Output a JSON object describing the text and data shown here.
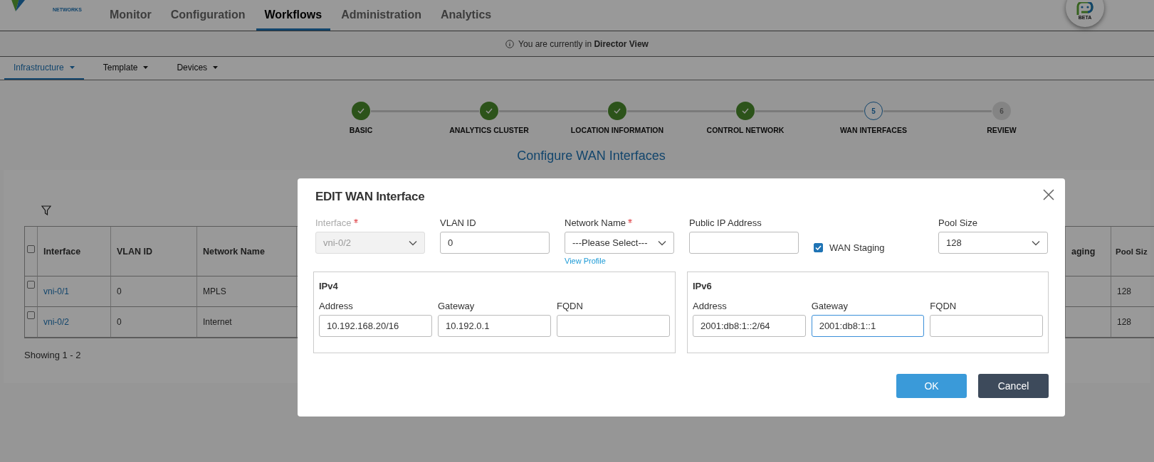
{
  "header": {
    "logo_text": "NETWORKS",
    "nav": [
      {
        "label": "Monitor",
        "selected": false
      },
      {
        "label": "Configuration",
        "selected": false
      },
      {
        "label": "Workflows",
        "selected": true
      },
      {
        "label": "Administration",
        "selected": false
      },
      {
        "label": "Analytics",
        "selected": false
      }
    ],
    "assistant_badge": "BETA"
  },
  "banner": {
    "text": "You are currently in **Director View**"
  },
  "subtabs": [
    {
      "label": "Infrastructure",
      "selected": true
    },
    {
      "label": "Template",
      "selected": false
    },
    {
      "label": "Devices",
      "selected": false
    }
  ],
  "stepper": {
    "steps": [
      {
        "label": "BASIC",
        "completed": true,
        "selected": false
      },
      {
        "label": "ANALYTICS CLUSTER",
        "completed": true,
        "selected": false
      },
      {
        "label": "LOCATION INFORMATION",
        "completed": true,
        "selected": false
      },
      {
        "label": "CONTROL NETWORK",
        "completed": true,
        "selected": false
      },
      {
        "label": "WAN INTERFACES",
        "completed": false,
        "selected": true,
        "number": "5"
      },
      {
        "label": "REVIEW",
        "completed": false,
        "selected": false,
        "number": "6"
      }
    ]
  },
  "page_title": "Configure WAN Interfaces",
  "table": {
    "header_checked": false,
    "columns": [
      "Interface",
      "VLAN ID",
      "Network Name",
      "aging",
      "Pool Siz"
    ],
    "rows": [
      {
        "checked": false,
        "interface": "vni-0/1",
        "vlan_id": "0",
        "network_name": "MPLS",
        "pool_size": "128"
      },
      {
        "checked": false,
        "interface": "vni-0/2",
        "vlan_id": "0",
        "network_name": "Internet",
        "pool_size": "128"
      }
    ],
    "footer": "Showing 1 - 2"
  },
  "dialog": {
    "title": "EDIT WAN Interface",
    "fields": [
      {
        "kind": "select",
        "label": "Interface",
        "required": true,
        "disabled": true,
        "value": "vni-0/2"
      },
      {
        "kind": "input",
        "label": "VLAN ID",
        "required": false,
        "disabled": false,
        "value": "0"
      },
      {
        "kind": "select",
        "label": "Network Name",
        "required": true,
        "disabled": false,
        "value": "---Please Select---",
        "link": "View Profile"
      },
      {
        "kind": "input",
        "label": "Public IP Address",
        "required": false,
        "disabled": false
      },
      {
        "kind": "checkbox",
        "label": "WAN Staging",
        "checked": true
      },
      {
        "kind": "select",
        "label": "Pool Size",
        "required": false,
        "disabled": false,
        "value": "128"
      }
    ],
    "sections": [
      {
        "title": "IPv4",
        "fields": [
          {
            "label": "Address",
            "value": "10.192.168.20/16",
            "focused": false
          },
          {
            "label": "Gateway",
            "value": "10.192.0.1",
            "focused": false
          },
          {
            "label": "FQDN",
            "focused": false
          }
        ]
      },
      {
        "title": "IPv6",
        "fields": [
          {
            "label": "Address",
            "value": "2001:db8:1::2/64",
            "focused": false
          },
          {
            "label": "Gateway",
            "value": "2001:db8:1::1",
            "focused": true
          },
          {
            "label": "FQDN",
            "focused": false
          }
        ]
      }
    ],
    "buttons": [
      {
        "label": "OK",
        "kind": "primary"
      },
      {
        "label": "Cancel",
        "kind": "secondary"
      }
    ]
  }
}
